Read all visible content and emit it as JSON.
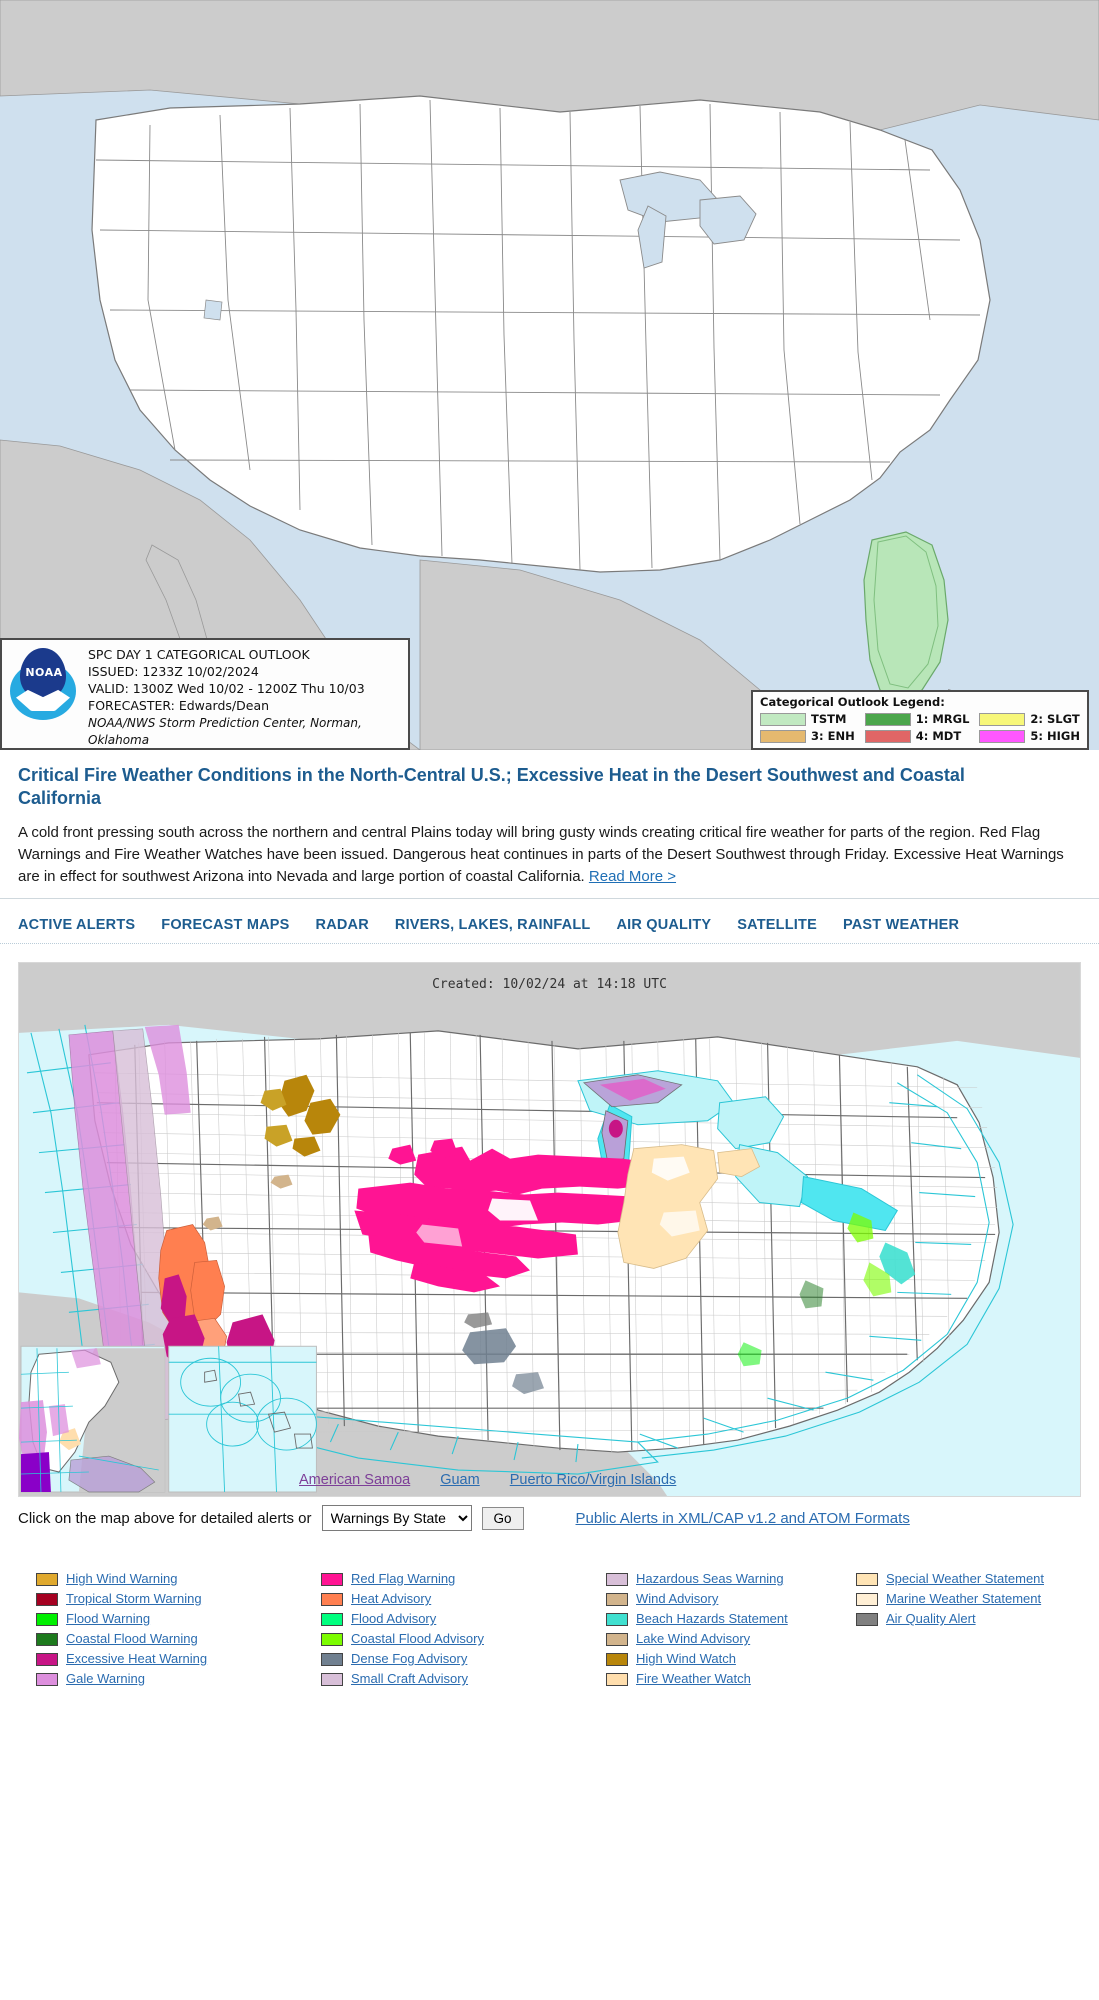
{
  "spc_map": {
    "info": {
      "title": "SPC DAY 1 CATEGORICAL OUTLOOK",
      "issued": "ISSUED: 1233Z 10/02/2024",
      "valid": "VALID: 1300Z Wed 10/02 - 1200Z Thu 10/03",
      "forecaster": "FORECASTER: Edwards/Dean",
      "credit": "NOAA/NWS Storm Prediction Center, Norman, Oklahoma",
      "logo_text": "NOAA"
    },
    "legend": {
      "title": "Categorical Outlook Legend:",
      "items": [
        {
          "label": "TSTM",
          "color": "#c1e9c1"
        },
        {
          "label": "1: MRGL",
          "color": "#4ca64c"
        },
        {
          "label": "2: SLGT",
          "color": "#f7f779"
        },
        {
          "label": "3: ENH",
          "color": "#e5b96f"
        },
        {
          "label": "4: MDT",
          "color": "#e06666"
        },
        {
          "label": "5: HIGH",
          "color": "#ff57ff"
        }
      ]
    },
    "colors": {
      "ocean": "#cfe0ee",
      "land_outside": "#cccccc",
      "states_fill": "#ffffff",
      "border": "#777777",
      "tstm": "#b8e6b8"
    }
  },
  "headline": {
    "title": "Critical Fire Weather Conditions in the North-Central U.S.; Excessive Heat in the Desert Southwest and Coastal California",
    "body": "A cold front pressing south across the northern and central Plains today will bring gusty winds creating critical fire weather for parts of the region. Red Flag Warnings and Fire Weather Watches have been issued. Dangerous heat continues in parts of the Desert Southwest through Friday. Excessive Heat Warnings are in effect for southwest Arizona into Nevada and large portion of coastal California.",
    "read_more": "Read More >"
  },
  "nav": {
    "tabs": [
      {
        "label": "ACTIVE ALERTS"
      },
      {
        "label": "FORECAST MAPS"
      },
      {
        "label": "RADAR"
      },
      {
        "label": "RIVERS, LAKES, RAINFALL"
      },
      {
        "label": "AIR QUALITY"
      },
      {
        "label": "SATELLITE"
      },
      {
        "label": "PAST WEATHER"
      }
    ]
  },
  "alerts_map": {
    "created": "Created: 10/02/24 at 14:18 UTC",
    "inset_links": [
      {
        "label": "American Samoa",
        "visited": true
      },
      {
        "label": "Guam",
        "visited": false
      },
      {
        "label": "Puerto Rico/Virgin Islands",
        "visited": false
      }
    ],
    "colors": {
      "ocean": "#d8f6fb",
      "marine_grid": "#2bc6d6",
      "land_outside": "#cccccc",
      "county": "#c9c9c9",
      "state": "#6b6b6b"
    }
  },
  "controls": {
    "prompt": "Click on the map above for detailed alerts or",
    "select_value": "Warnings By State",
    "select_options": [
      "Warnings By State"
    ],
    "go_label": "Go",
    "xml_link": "Public Alerts in XML/CAP v1.2 and ATOM Formats"
  },
  "bottom_legend": {
    "columns": [
      [
        {
          "label": "High Wind Warning",
          "color": "#e0a92e"
        },
        {
          "label": "Tropical Storm Warning",
          "color": "#a50021"
        },
        {
          "label": "Flood Warning",
          "color": "#00f000"
        },
        {
          "label": "Coastal Flood Warning",
          "color": "#1d7a1d"
        },
        {
          "label": "Excessive Heat Warning",
          "color": "#c71585"
        },
        {
          "label": "Gale Warning",
          "color": "#dd8fdd"
        }
      ],
      [
        {
          "label": "Red Flag Warning",
          "color": "#ff1493"
        },
        {
          "label": "Heat Advisory",
          "color": "#ff7f50"
        },
        {
          "label": "Flood Advisory",
          "color": "#00ff7f"
        },
        {
          "label": "Coastal Flood Advisory",
          "color": "#7cfc00"
        },
        {
          "label": "Dense Fog Advisory",
          "color": "#708090"
        },
        {
          "label": "Small Craft Advisory",
          "color": "#d8bfd8"
        }
      ],
      [
        {
          "label": "Hazardous Seas Warning",
          "color": "#d8bfd8"
        },
        {
          "label": "Wind Advisory",
          "color": "#d2b48c"
        },
        {
          "label": "Beach Hazards Statement",
          "color": "#40e0d0"
        },
        {
          "label": "Lake Wind Advisory",
          "color": "#d2b48c"
        },
        {
          "label": "High Wind Watch",
          "color": "#b8860b"
        },
        {
          "label": "Fire Weather Watch",
          "color": "#ffdead"
        }
      ],
      [
        {
          "label": "Special Weather Statement",
          "color": "#ffe4b5"
        },
        {
          "label": "Marine Weather Statement",
          "color": "#ffefd5"
        },
        {
          "label": "Air Quality Alert",
          "color": "#808080"
        }
      ]
    ]
  }
}
